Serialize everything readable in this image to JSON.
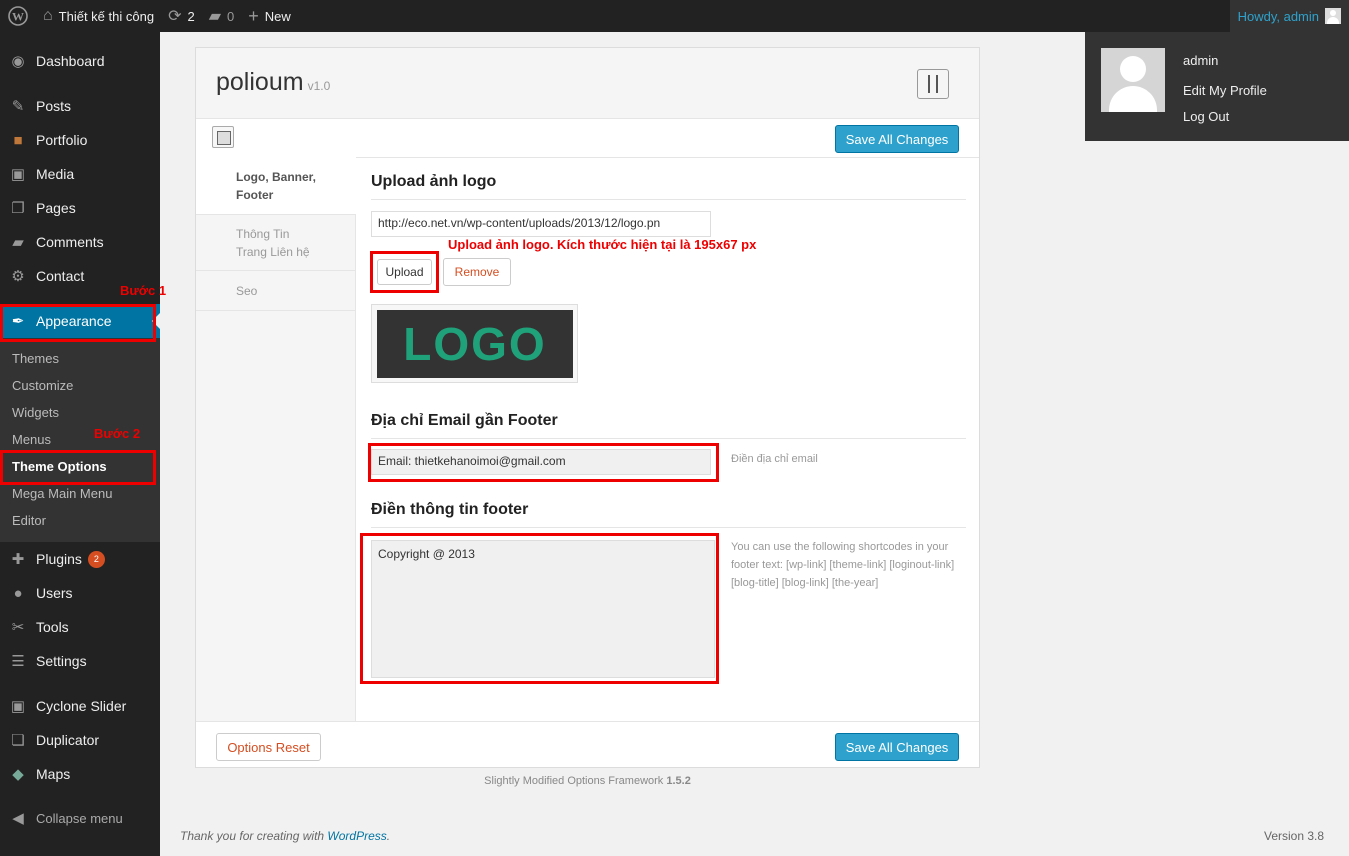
{
  "adminbar": {
    "site_name": "Thiết kế thi công",
    "updates_count": "2",
    "comments_count": "0",
    "new_label": "New",
    "howdy": "Howdy, admin"
  },
  "user_menu": {
    "name": "admin",
    "edit_profile": "Edit My Profile",
    "logout": "Log Out"
  },
  "sidebar": {
    "items": [
      {
        "label": "Dashboard",
        "icon": "dashboard-icon"
      },
      {
        "label": "Posts",
        "icon": "pin-icon"
      },
      {
        "label": "Portfolio",
        "icon": "briefcase-icon"
      },
      {
        "label": "Media",
        "icon": "media-icon"
      },
      {
        "label": "Pages",
        "icon": "pages-icon"
      },
      {
        "label": "Comments",
        "icon": "comment-icon"
      },
      {
        "label": "Contact",
        "icon": "gear-icon"
      },
      {
        "label": "Appearance",
        "icon": "brush-icon"
      },
      {
        "label": "Plugins",
        "icon": "plug-icon",
        "badge": "2"
      },
      {
        "label": "Users",
        "icon": "user-icon"
      },
      {
        "label": "Tools",
        "icon": "wrench-icon"
      },
      {
        "label": "Settings",
        "icon": "settings-icon"
      },
      {
        "label": "Cyclone Slider",
        "icon": "media-icon"
      },
      {
        "label": "Duplicator",
        "icon": "copy-icon"
      },
      {
        "label": "Maps",
        "icon": "map-icon"
      }
    ],
    "submenu": [
      "Themes",
      "Customize",
      "Widgets",
      "Menus",
      "Theme Options",
      "Mega Main Menu",
      "Editor"
    ],
    "collapse": "Collapse menu"
  },
  "annotations": {
    "step1": "Bước 1",
    "step2": "Bước 2",
    "upload_note": "Upload ảnh logo. Kích thước hiện tại là 195x67 px"
  },
  "panel": {
    "title": "polioum",
    "version": "v1.0",
    "save_label": "Save All Changes",
    "reset_label": "Options Reset",
    "tabs": [
      "Logo, Banner, Footer",
      "Thông Tin Trang Liên hệ",
      "Seo"
    ],
    "logo_section": {
      "title": "Upload ảnh logo",
      "url_value": "http://eco.net.vn/wp-content/uploads/2013/12/logo.pn",
      "upload": "Upload",
      "remove": "Remove",
      "logo_text": "LOGO"
    },
    "email_section": {
      "title": "Địa chỉ Email gần Footer",
      "value": "Email: thietkehanoimoi@gmail.com",
      "help": "Điền địa chỉ email"
    },
    "footer_section": {
      "title": "Điền thông tin footer",
      "value": "Copyright @ 2013",
      "help": "You can use the following shortcodes in your footer text: [wp-link] [theme-link] [loginout-link] [blog-title] [blog-link] [the-year]"
    }
  },
  "framework_note": "Slightly Modified Options Framework",
  "framework_version": "1.5.2",
  "footer": {
    "thanks_prefix": "Thank you for creating with ",
    "wordpress": "WordPress",
    "thanks_suffix": ".",
    "version": "Version 3.8"
  }
}
